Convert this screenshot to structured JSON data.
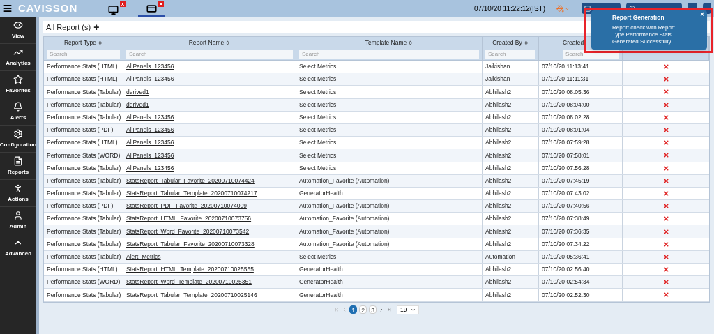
{
  "topbar": {
    "logo": "CAVISSON",
    "tabs": [
      {
        "kind": "monitor",
        "selected": false
      },
      {
        "kind": "card",
        "selected": true
      }
    ],
    "datetime": "07/10/20 11:22:12(IST)"
  },
  "sidebar": {
    "items": [
      {
        "label": "View"
      },
      {
        "label": "Analytics"
      },
      {
        "label": "Favorites"
      },
      {
        "label": "Alerts"
      },
      {
        "label": "Configuration"
      },
      {
        "label": "Reports"
      },
      {
        "label": "Actions"
      },
      {
        "label": "Admin"
      },
      {
        "label": "Advanced"
      }
    ]
  },
  "panel": {
    "title": "All Report (s)",
    "add": "+"
  },
  "table": {
    "columns": [
      {
        "label": "Report Type",
        "placeholder": "Search"
      },
      {
        "label": "Report Name",
        "placeholder": "Search"
      },
      {
        "label": "Template Name",
        "placeholder": "Search"
      },
      {
        "label": "Created By",
        "placeholder": "Search"
      },
      {
        "label": "Created",
        "placeholder": "Search"
      }
    ],
    "rows": [
      [
        "Performance Stats (HTML)",
        "AllPanels_123456",
        "Select Metrics",
        "Jaikishan",
        "07/10/20 11:13:41"
      ],
      [
        "Performance Stats (HTML)",
        "AllPanels_123456",
        "Select Metrics",
        "Jaikishan",
        "07/10/20 11:11:31"
      ],
      [
        "Performance Stats (Tabular)",
        "derived1",
        "Select Metrics",
        "Abhilash2",
        "07/10/20 08:05:36"
      ],
      [
        "Performance Stats (Tabular)",
        "derived1",
        "Select Metrics",
        "Abhilash2",
        "07/10/20 08:04:00"
      ],
      [
        "Performance Stats (Tabular)",
        "AllPanels_123456",
        "Select Metrics",
        "Abhilash2",
        "07/10/20 08:02:28"
      ],
      [
        "Performance Stats (PDF)",
        "AllPanels_123456",
        "Select Metrics",
        "Abhilash2",
        "07/10/20 08:01:04"
      ],
      [
        "Performance Stats (HTML)",
        "AllPanels_123456",
        "Select Metrics",
        "Abhilash2",
        "07/10/20 07:59:28"
      ],
      [
        "Performance Stats (WORD)",
        "AllPanels_123456",
        "Select Metrics",
        "Abhilash2",
        "07/10/20 07:58:01"
      ],
      [
        "Performance Stats (Tabular)",
        "AllPanels_123456",
        "Select Metrics",
        "Abhilash2",
        "07/10/20 07:56:28"
      ],
      [
        "Performance Stats (Tabular)",
        "StatsReport_Tabular_Favorite_20200710074424",
        "Automation_Favorite (Automation)",
        "Abhilash2",
        "07/10/20 07:45:19"
      ],
      [
        "Performance Stats (Tabular)",
        "StatsReport_Tabular_Template_20200710074217",
        "GeneratorHealth",
        "Abhilash2",
        "07/10/20 07:43:02"
      ],
      [
        "Performance Stats (PDF)",
        "StatsReport_PDF_Favorite_20200710074009",
        "Automation_Favorite (Automation)",
        "Abhilash2",
        "07/10/20 07:40:56"
      ],
      [
        "Performance Stats (Tabular)",
        "StatsReport_HTML_Favorite_20200710073756",
        "Automation_Favorite (Automation)",
        "Abhilash2",
        "07/10/20 07:38:49"
      ],
      [
        "Performance Stats (Tabular)",
        "StatsReport_Word_Favorite_20200710073542",
        "Automation_Favorite (Automation)",
        "Abhilash2",
        "07/10/20 07:36:35"
      ],
      [
        "Performance Stats (Tabular)",
        "StatsReport_Tabular_Favorite_20200710073328",
        "Automation_Favorite (Automation)",
        "Abhilash2",
        "07/10/20 07:34:22"
      ],
      [
        "Performance Stats (Tabular)",
        "Alert_Metrics",
        "Select Metrics",
        "Automation",
        "07/10/20 05:36:41"
      ],
      [
        "Performance Stats (HTML)",
        "StatsReport_HTML_Template_20200710025555",
        "GeneratorHealth",
        "Abhilash2",
        "07/10/20 02:56:40"
      ],
      [
        "Performance Stats (WORD)",
        "StatsReport_Word_Template_20200710025351",
        "GeneratorHealth",
        "Abhilash2",
        "07/10/20 02:54:34"
      ],
      [
        "Performance Stats (Tabular)",
        "StatsReport_Tabular_Template_20200710025146",
        "GeneratorHealth",
        "Abhilash2",
        "07/10/20 02:52:30"
      ]
    ]
  },
  "pagination": {
    "pages": [
      {
        "label": "1",
        "selected": true
      },
      {
        "label": "2",
        "selected": false
      },
      {
        "label": "3",
        "selected": false
      }
    ],
    "page_size": "19"
  },
  "toast": {
    "title": "Report Generation",
    "message": "Report check with Report Type Performance Stats Generated Successfully.",
    "close": "×"
  }
}
